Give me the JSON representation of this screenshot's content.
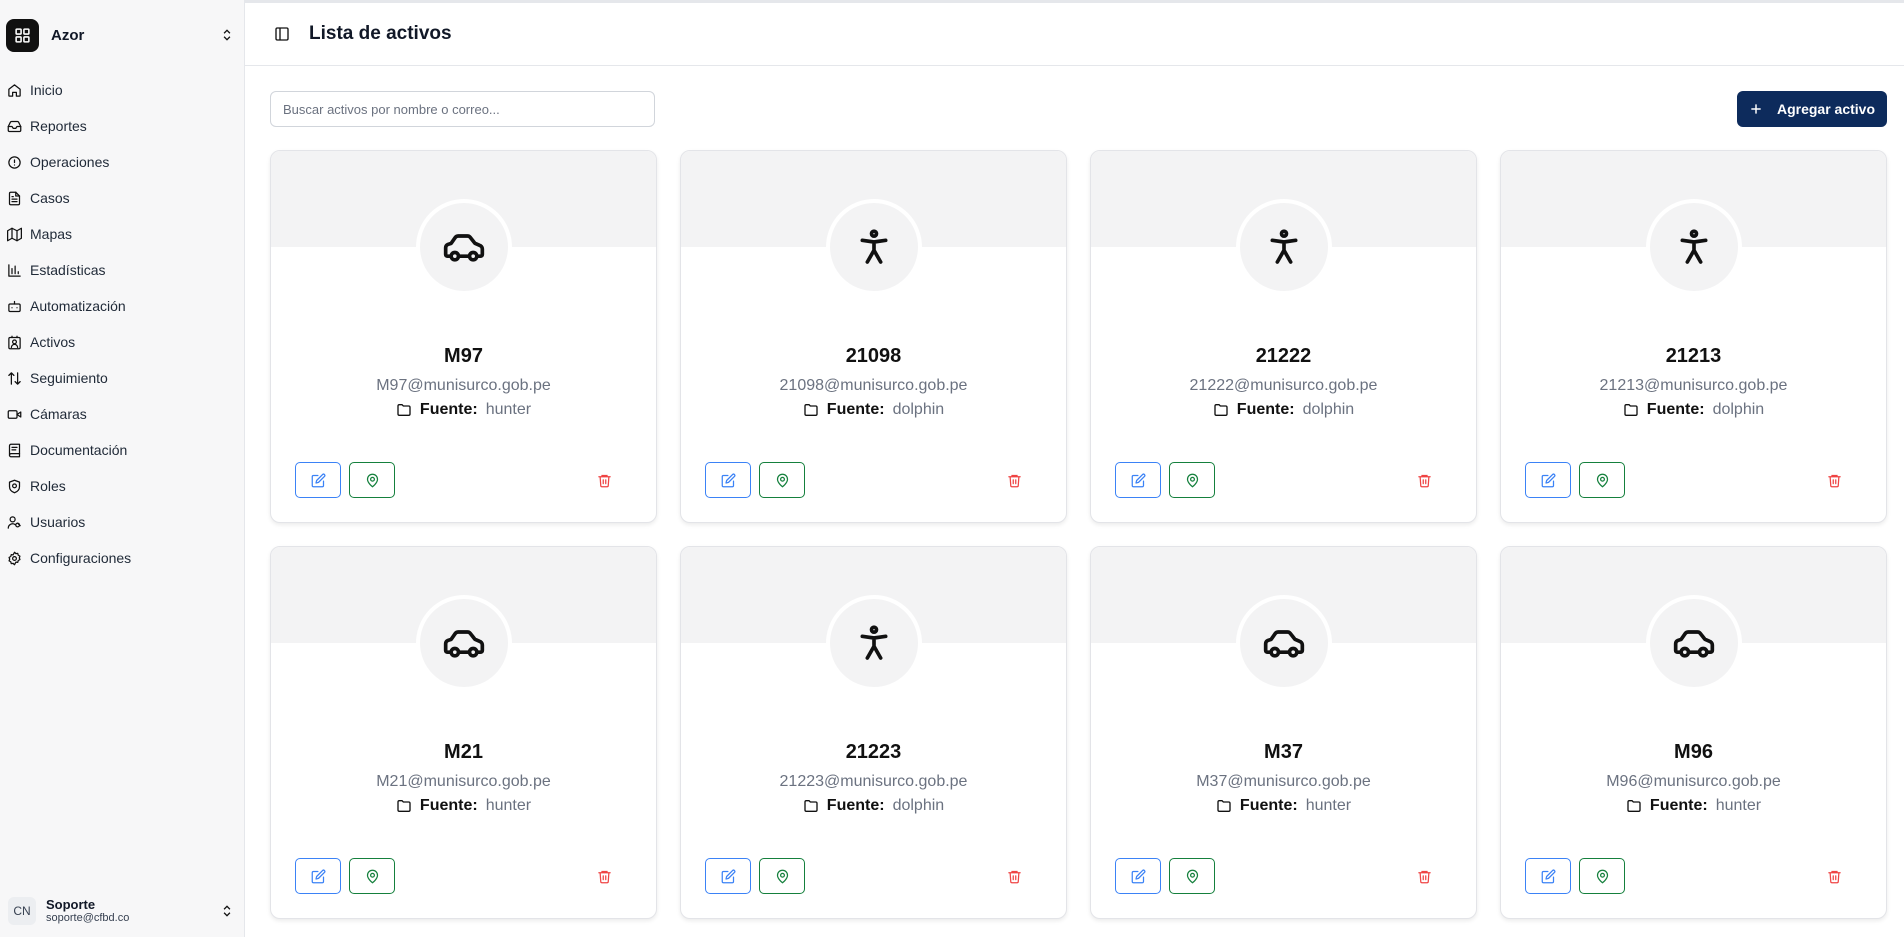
{
  "org": {
    "name": "Azor",
    "logo_icon": "grid-icon"
  },
  "nav": [
    {
      "label": "Inicio",
      "icon": "home-icon"
    },
    {
      "label": "Reportes",
      "icon": "inbox-icon"
    },
    {
      "label": "Operaciones",
      "icon": "alert-circle-icon"
    },
    {
      "label": "Casos",
      "icon": "file-text-icon"
    },
    {
      "label": "Mapas",
      "icon": "map-icon"
    },
    {
      "label": "Estadísticas",
      "icon": "bar-chart-icon"
    },
    {
      "label": "Automatización",
      "icon": "bot-icon"
    },
    {
      "label": "Activos",
      "icon": "contact-icon"
    },
    {
      "label": "Seguimiento",
      "icon": "arrow-up-down-icon"
    },
    {
      "label": "Cámaras",
      "icon": "video-icon"
    },
    {
      "label": "Documentación",
      "icon": "book-icon"
    },
    {
      "label": "Roles",
      "icon": "shield-icon"
    },
    {
      "label": "Usuarios",
      "icon": "user-key-icon"
    },
    {
      "label": "Configuraciones",
      "icon": "settings-icon"
    }
  ],
  "user": {
    "initials": "CN",
    "name": "Soporte",
    "email": "soporte@cfbd.co"
  },
  "header": {
    "title": "Lista de activos"
  },
  "search": {
    "placeholder": "Buscar activos por nombre o correo...",
    "value": ""
  },
  "add_button": {
    "label": "Agregar activo"
  },
  "source_label": "Fuente:",
  "colors": {
    "primary": "#0d2b5c",
    "edit": "#3b82f6",
    "location": "#15803d",
    "delete": "#ef4444"
  },
  "assets": [
    {
      "name": "M97",
      "email": "M97@munisurco.gob.pe",
      "source": "hunter",
      "type": "car-icon"
    },
    {
      "name": "21098",
      "email": "21098@munisurco.gob.pe",
      "source": "dolphin",
      "type": "person-icon"
    },
    {
      "name": "21222",
      "email": "21222@munisurco.gob.pe",
      "source": "dolphin",
      "type": "person-icon"
    },
    {
      "name": "21213",
      "email": "21213@munisurco.gob.pe",
      "source": "dolphin",
      "type": "person-icon"
    },
    {
      "name": "M21",
      "email": "M21@munisurco.gob.pe",
      "source": "hunter",
      "type": "car-icon"
    },
    {
      "name": "21223",
      "email": "21223@munisurco.gob.pe",
      "source": "dolphin",
      "type": "person-icon"
    },
    {
      "name": "M37",
      "email": "M37@munisurco.gob.pe",
      "source": "hunter",
      "type": "car-icon"
    },
    {
      "name": "M96",
      "email": "M96@munisurco.gob.pe",
      "source": "hunter",
      "type": "car-icon"
    }
  ]
}
